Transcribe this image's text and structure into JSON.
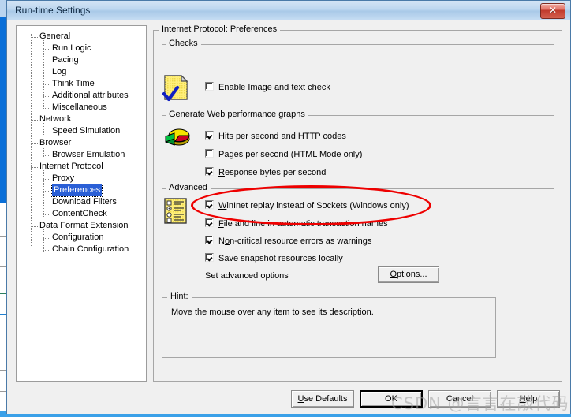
{
  "window": {
    "title": "Run-time Settings",
    "close_label": "✕",
    "close_icon": "close-icon"
  },
  "tree": {
    "nodes": [
      {
        "label": "General",
        "depth": 0,
        "selected": false
      },
      {
        "label": "Run Logic",
        "depth": 1,
        "selected": false
      },
      {
        "label": "Pacing",
        "depth": 1,
        "selected": false
      },
      {
        "label": "Log",
        "depth": 1,
        "selected": false
      },
      {
        "label": "Think Time",
        "depth": 1,
        "selected": false
      },
      {
        "label": "Additional attributes",
        "depth": 1,
        "selected": false
      },
      {
        "label": "Miscellaneous",
        "depth": 1,
        "selected": false
      },
      {
        "label": "Network",
        "depth": 0,
        "selected": false
      },
      {
        "label": "Speed Simulation",
        "depth": 1,
        "selected": false
      },
      {
        "label": "Browser",
        "depth": 0,
        "selected": false
      },
      {
        "label": "Browser Emulation",
        "depth": 1,
        "selected": false
      },
      {
        "label": "Internet Protocol",
        "depth": 0,
        "selected": false
      },
      {
        "label": "Proxy",
        "depth": 1,
        "selected": false
      },
      {
        "label": "Preferences",
        "depth": 1,
        "selected": true
      },
      {
        "label": "Download Filters",
        "depth": 1,
        "selected": false
      },
      {
        "label": "ContentCheck",
        "depth": 1,
        "selected": false
      },
      {
        "label": "Data Format Extension",
        "depth": 0,
        "selected": false
      },
      {
        "label": "Configuration",
        "depth": 1,
        "selected": false
      },
      {
        "label": "Chain Configuration",
        "depth": 1,
        "selected": false
      }
    ]
  },
  "panel": {
    "title": "Internet Protocol: Preferences",
    "groups": {
      "checks": {
        "label": "Checks",
        "icon": "document-check-icon",
        "items": [
          {
            "label": "Enable Image and text check",
            "checked": false,
            "mnemonic": "E"
          }
        ]
      },
      "graphs": {
        "label": "Generate Web performance graphs",
        "icon": "pie-chart-icon",
        "items": [
          {
            "label": "Hits per second and HTTP codes",
            "checked": true,
            "mnemonic": "T"
          },
          {
            "label": "Pages per second (HTML Mode only)",
            "checked": false,
            "mnemonic": "M"
          },
          {
            "label": "Response bytes per second",
            "checked": true,
            "mnemonic": "R"
          }
        ]
      },
      "advanced": {
        "label": "Advanced",
        "icon": "form-list-icon",
        "items": [
          {
            "label": "WinInet replay instead of Sockets (Windows only)",
            "checked": true,
            "mnemonic": "W"
          },
          {
            "label": "File and line in automatic transaction names",
            "checked": true,
            "mnemonic": "F"
          },
          {
            "label": "Non-critical resource errors as warnings",
            "checked": true,
            "mnemonic": "o"
          },
          {
            "label": "Save snapshot resources locally",
            "checked": true,
            "mnemonic": "a"
          }
        ],
        "set_options_label": "Set advanced options",
        "options_button": "Options..."
      },
      "hint": {
        "label": "Hint:",
        "text": "Move the mouse over any item to see its description."
      }
    }
  },
  "footer": {
    "buttons": [
      {
        "name": "use-defaults-button",
        "label": "Use Defaults",
        "default": false
      },
      {
        "name": "ok-button",
        "label": "OK",
        "default": true
      },
      {
        "name": "cancel-button",
        "label": "Cancel",
        "default": false
      },
      {
        "name": "help-button",
        "label": "Help",
        "default": false
      }
    ]
  },
  "annotation": {
    "shape": "ellipse",
    "color": "#ee0000",
    "target": "WinInet replay instead of Sockets (Windows only)"
  },
  "watermark": {
    "text": "CSDN @言言在敲代码"
  },
  "colors": {
    "title_bar_start": "#d3e4f5",
    "title_bar_end": "#a9c9e8",
    "dialog_face": "#f0f0f0",
    "selection": "#2a5fd6",
    "annotation": "#ee0000",
    "close_button": "#c03a2c"
  }
}
